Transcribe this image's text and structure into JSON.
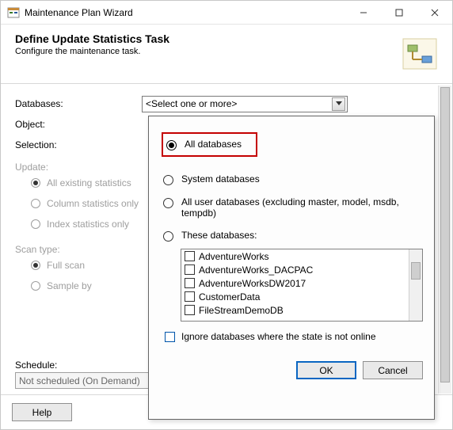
{
  "window": {
    "title": "Maintenance Plan Wizard"
  },
  "header": {
    "heading": "Define Update Statistics Task",
    "subtitle": "Configure the maintenance task."
  },
  "form": {
    "databases_label": "Databases:",
    "databases_value": "<Select one or more>",
    "object_label": "Object:",
    "selection_label": "Selection:",
    "update_group": "Update:",
    "update_options": {
      "all_existing": "All existing statistics",
      "column_only": "Column statistics only",
      "index_only": "Index statistics only"
    },
    "scan_group": "Scan type:",
    "scan_options": {
      "full": "Full scan",
      "sample": "Sample by"
    },
    "schedule_label": "Schedule:",
    "schedule_value": "Not scheduled (On Demand)"
  },
  "footer": {
    "help": "Help"
  },
  "dropdown": {
    "all_databases": "All databases",
    "system_databases": "System databases",
    "all_user": "All user databases  (excluding master, model, msdb, tempdb)",
    "these_databases": "These databases:",
    "db_list": [
      "AdventureWorks",
      "AdventureWorks_DACPAC",
      "AdventureWorksDW2017",
      "CustomerData",
      "FileStreamDemoDB"
    ],
    "ignore_label": "Ignore databases where the state is not online",
    "ok": "OK",
    "cancel": "Cancel"
  }
}
